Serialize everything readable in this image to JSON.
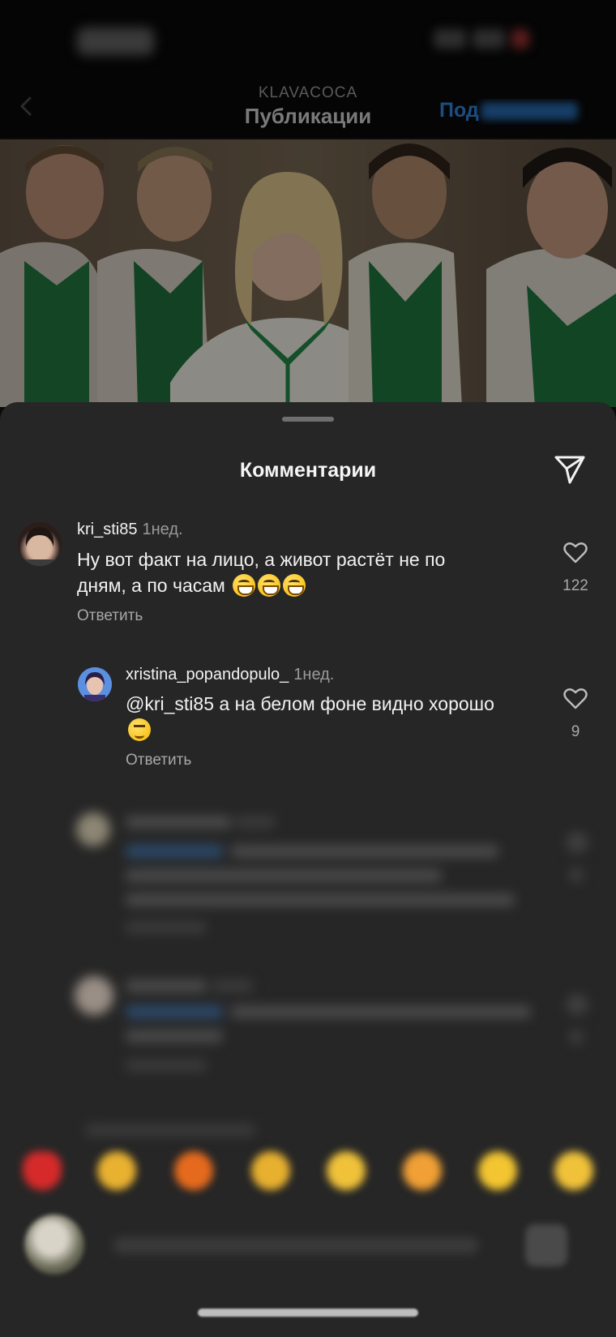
{
  "header": {
    "profile_name": "KLAVACOCA",
    "title": "Публикации",
    "follow_label": "Под"
  },
  "sheet": {
    "title": "Комментарии"
  },
  "comments": [
    {
      "username": "kri_sti85",
      "time": "1нед.",
      "text_line1": "Ну вот факт на лицо, а живот растёт не по",
      "text_line2": "дням, а по часам",
      "reply_label": "Ответить",
      "likes": "122"
    },
    {
      "username": "xristina_popandopulo_",
      "time": "1нед.",
      "mention": "@kri_sti85",
      "text_line1": " а на белом фоне видно хорошо",
      "reply_label": "Ответить",
      "likes": "9"
    }
  ],
  "icons": {
    "back": "chevron-left-icon",
    "share": "paper-plane-icon",
    "like": "heart-outline-icon",
    "emoji": "grinning-face-icon"
  },
  "colors": {
    "sheet_bg": "#262626",
    "link_blue": "#1d4d80"
  }
}
